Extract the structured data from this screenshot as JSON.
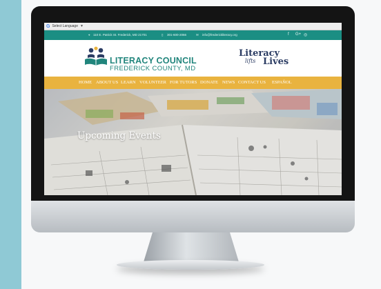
{
  "translate": {
    "label": "Select Language",
    "g": "G",
    "caret": "▼"
  },
  "contact": {
    "address": "110 E. Patrick St. Frederick, MD 21701",
    "phone": "301-600-2066",
    "email": "info@frederickliteracy.org",
    "social": [
      "f",
      "G+",
      "◎"
    ]
  },
  "logo": {
    "title": "LITERACY COUNCIL",
    "subtitle": "FREDERICK COUNTY, MD"
  },
  "slogan": {
    "line1": "Literacy",
    "line2": "lifts",
    "line3": "Lives"
  },
  "nav": [
    "HOME",
    "ABOUT US",
    "LEARN",
    "VOLUNTEER",
    "FOR TUTORS",
    "DONATE",
    "NEWS",
    "CONTACT US",
    "ESPAÑOL"
  ],
  "hero": {
    "title": "Upcoming Events"
  },
  "colors": {
    "teal": "#1b8e83",
    "gold": "#e9b33f",
    "navy": "#2b3c63"
  }
}
